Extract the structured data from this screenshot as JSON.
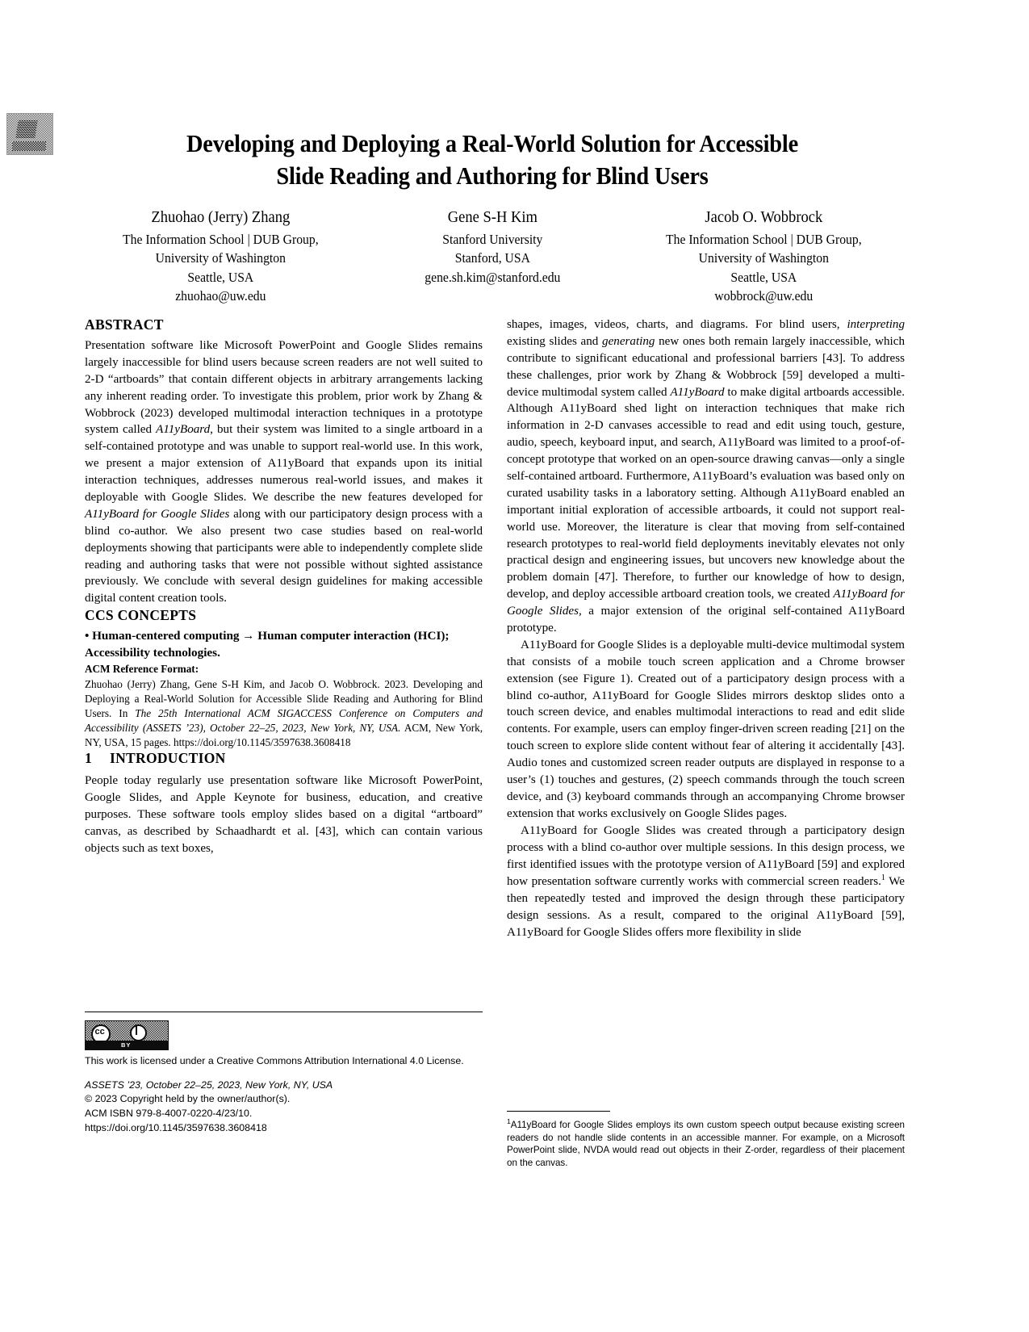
{
  "document": {
    "type": "academic-paper-first-page",
    "title": "Developing and Deploying a Real-World Solution for Accessible Slide Reading and Authoring for Blind Users",
    "title_line1": "Developing and Deploying a Real-World Solution for Accessible",
    "title_line2": "Slide Reading and Authoring for Blind Users"
  },
  "badge": {
    "name": "acm-artifact-badge"
  },
  "authors": [
    {
      "name": "Zhuohao (Jerry) Zhang",
      "affiliation_line1": "The Information School | DUB Group,",
      "affiliation_line2": "University of Washington",
      "location": "Seattle, USA",
      "email": "zhuohao@uw.edu"
    },
    {
      "name": "Gene S-H Kim",
      "affiliation_line1": "Stanford University",
      "affiliation_line2": "",
      "location": "Stanford, USA",
      "email": "gene.sh.kim@stanford.edu"
    },
    {
      "name": "Jacob O. Wobbrock",
      "affiliation_line1": "The Information School | DUB Group,",
      "affiliation_line2": "University of Washington",
      "location": "Seattle, USA",
      "email": "wobbrock@uw.edu"
    }
  ],
  "left_column": {
    "abstract_heading": "ABSTRACT",
    "abstract_part1": "Presentation software like Microsoft PowerPoint and Google Slides remains largely inaccessible for blind users because screen readers are not well suited to 2-D “artboards” that contain different objects in arbitrary arrangements lacking any inherent reading order. To investigate this problem, prior work by Zhang & Wobbrock (2023) developed multimodal interaction techniques in a prototype system called ",
    "abstract_italic1": "A11yBoard",
    "abstract_part2": ", but their system was limited to a single artboard in a self-contained prototype and was unable to support real-world use. In this work, we present a major extension of A11yBoard that expands upon its initial interaction techniques, addresses numerous real-world issues, and makes it deployable with Google Slides. We describe the new features developed for ",
    "abstract_italic2": "A11yBoard for Google Slides",
    "abstract_part3": " along with our participatory design process with a blind co-author. We also present two case studies based on real-world deployments showing that participants were able to independently complete slide reading and authoring tasks that were not possible without sighted assistance previously. We conclude with several design guidelines for making accessible digital content creation tools.",
    "ccs_heading": "CCS CONCEPTS",
    "ccs_text": "• Human-centered computing → Human computer interaction (HCI); Accessibility technologies.",
    "reference_heading": "ACM Reference Format:",
    "reference_part1": "Zhuohao (Jerry) Zhang, Gene S-H Kim, and Jacob O. Wobbrock. 2023. Developing and Deploying a Real-World Solution for Accessible Slide Reading and Authoring for Blind Users. In ",
    "reference_italic": "The 25th International ACM SIGACCESS Conference on Computers and Accessibility (ASSETS ’23), October 22–25, 2023, New York, NY, USA.",
    "reference_part2": " ACM, New York, NY, USA, 15 pages. https://doi.org/10.1145/3597638.3608418",
    "intro_number": "1",
    "intro_heading": "INTRODUCTION",
    "intro_text": "People today regularly use presentation software like Microsoft PowerPoint, Google Slides, and Apple Keynote for business, education, and creative purposes. These software tools employ slides based on a digital “artboard” canvas, as described by Schaadhardt et al. [43], which can contain various objects such as text boxes,"
  },
  "right_column": {
    "para1_part1": "shapes, images, videos, charts, and diagrams. For blind users, ",
    "para1_italic1": "interpreting",
    "para1_part2": " existing slides and ",
    "para1_italic2": "generating",
    "para1_part3": " new ones both remain largely inaccessible, which contribute to significant educational and professional barriers [43]. To address these challenges, prior work by Zhang & Wobbrock [59] developed a multi-device multimodal system called ",
    "para1_italic3": "A11yBoard",
    "para1_part4": " to make digital artboards accessible. Although A11yBoard shed light on interaction techniques that make rich information in 2-D canvases accessible to read and edit using touch, gesture, audio, speech, keyboard input, and search, A11yBoard was limited to a proof-of-concept prototype that worked on an open-source drawing canvas—only a single self-contained artboard. Furthermore, A11yBoard’s evaluation was based only on curated usability tasks in a laboratory setting. Although A11yBoard enabled an important initial exploration of accessible artboards, it could not support real-world use. Moreover, the literature is clear that moving from self-contained research prototypes to real-world field deployments inevitably elevates not only practical design and engineering issues, but uncovers new knowledge about the problem domain [47]. Therefore, to further our knowledge of how to design, develop, and deploy accessible artboard creation tools, we created ",
    "para1_italic4": "A11yBoard for Google Slides",
    "para1_part5": ", a major extension of the original self-contained A11yBoard prototype.",
    "para2": "A11yBoard for Google Slides is a deployable multi-device multimodal system that consists of a mobile touch screen application and a Chrome browser extension (see Figure 1). Created out of a participatory design process with a blind co-author, A11yBoard for Google Slides mirrors desktop slides onto a touch screen device, and enables multimodal interactions to read and edit slide contents. For example, users can employ finger-driven screen reading [21] on the touch screen to explore slide content without fear of altering it accidentally [43]. Audio tones and customized screen reader outputs are displayed in response to a user’s (1) touches and gestures, (2) speech commands through the touch screen device, and (3) keyboard commands through an accompanying Chrome browser extension that works exclusively on Google Slides pages.",
    "para3_part1": "A11yBoard for Google Slides was created through a participatory design process with a blind co-author over multiple sessions. In this design process, we first identified issues with the prototype version of A11yBoard [59] and explored how presentation software currently works with commercial screen readers.",
    "para3_footnote_marker": "1",
    "para3_part2": " We then repeatedly tested and improved the design through these participatory design sessions. As a result, compared to the original A11yBoard [59], A11yBoard for Google Slides offers more flexibility in slide",
    "footnote_marker": "1",
    "footnote_text": "A11yBoard for Google Slides employs its own custom speech output because existing screen readers do not handle slide contents in an accessible manner. For example, on a Microsoft PowerPoint slide, NVDA would read out objects in their Z-order, regardless of their placement on the canvas."
  },
  "footer": {
    "license_badge_label": "BY",
    "license_badge_name": "creative-commons-by-badge",
    "license_text": "This work is licensed under a Creative Commons Attribution International 4.0 License.",
    "venue": "ASSETS ’23, October 22–25, 2023, New York, NY, USA",
    "copyright": "© 2023 Copyright held by the owner/author(s).",
    "isbn": "ACM ISBN 979-8-4007-0220-4/23/10.",
    "doi": "https://doi.org/10.1145/3597638.3608418"
  }
}
